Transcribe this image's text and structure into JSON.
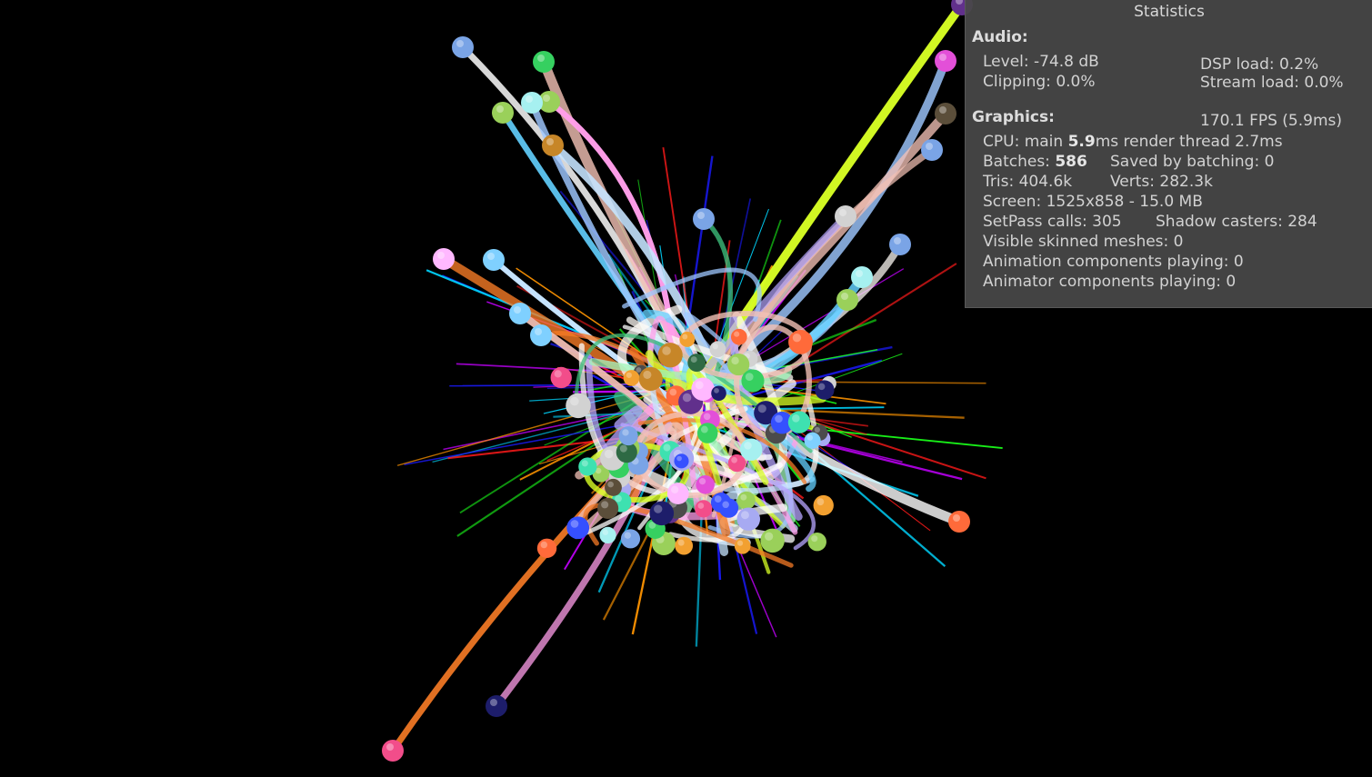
{
  "stats": {
    "title": "Statistics",
    "audio": {
      "header": "Audio:",
      "level": "Level: -74.8 dB",
      "dsp_load": "DSP load: 0.2%",
      "clipping": "Clipping: 0.0%",
      "stream_load": "Stream load: 0.0%"
    },
    "graphics": {
      "header": "Graphics:",
      "fps": "170.1 FPS (5.9ms)",
      "cpu_prefix": "CPU: main ",
      "cpu_main": "5.9",
      "cpu_suffix": "ms  render thread 2.7ms",
      "batches_prefix": "Batches: ",
      "batches": "586",
      "saved_by_batching": "Saved by batching: 0",
      "tris": "Tris: 404.6k",
      "verts": "Verts: 282.3k",
      "screen": "Screen: 1525x858 - 15.0 MB",
      "setpass": "SetPass calls: 305",
      "shadow_casters": "Shadow casters: 284",
      "skinned_meshes": "Visible skinned meshes: 0",
      "animation_components": "Animation components playing: 0",
      "animator_components": "Animator components playing: 0"
    }
  },
  "scene": {
    "background": "#000000",
    "trail_palette": [
      "#ffffff",
      "#c6e4ff",
      "#9ec7ff",
      "#b7a6ff",
      "#f3c1b5",
      "#d8ff24",
      "#f47a25",
      "#63d0ff",
      "#9ff5b8",
      "#ff9dea",
      "#3dbd7a",
      "#fffbf6"
    ],
    "ray_palette": [
      "#ff1a1a",
      "#1a1aff",
      "#1aff1a",
      "#ff9400",
      "#00d6ff",
      "#c400ff"
    ],
    "ball_palette": [
      "#a7aaf2",
      "#3ee1b0",
      "#9ad05a",
      "#f2a030",
      "#e34fd8",
      "#c78628",
      "#3550ff",
      "#7fd0ff",
      "#61308c",
      "#2e6a44",
      "#f24d8a",
      "#a6f0f0",
      "#d2d2d2",
      "#7aa4e6",
      "#1d1d6a",
      "#ff6a3a",
      "#5b4e3a",
      "#36d060",
      "#ffb8ff",
      "#4b4b4b"
    ]
  }
}
